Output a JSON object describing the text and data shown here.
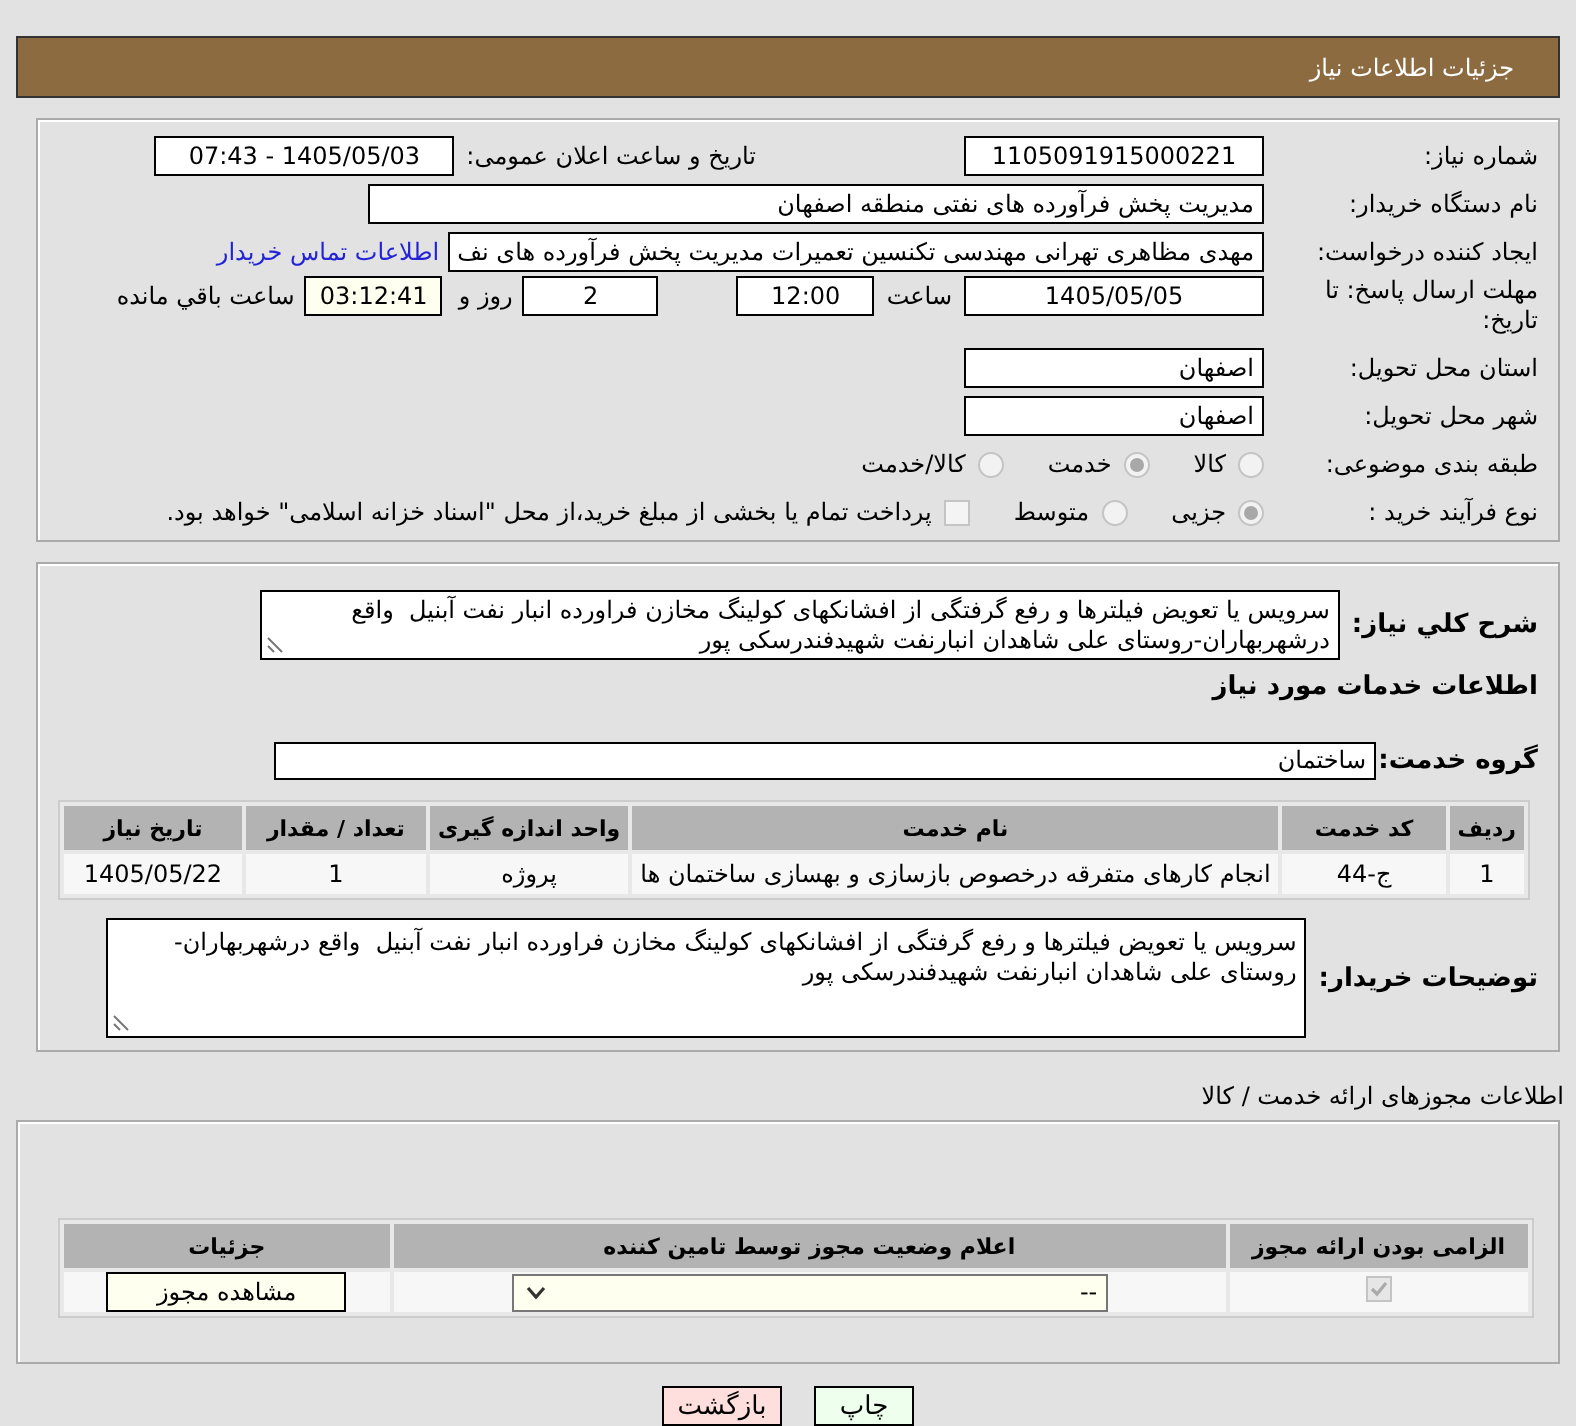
{
  "header": {
    "title": "جزئیات اطلاعات نیاز"
  },
  "need_details": {
    "need_number": {
      "label": "شماره نیاز:",
      "value": "1105091915000221"
    },
    "announcement": {
      "label": "تاریخ و ساعت اعلان عمومی:",
      "value": "1405/05/03 - 07:43"
    },
    "buyer_org": {
      "label": "نام دستگاه خریدار:",
      "value": "مدیریت پخش فرآورده های نفتی منطقه اصفهان"
    },
    "requester": {
      "label": "ایجاد کننده درخواست:",
      "value": "مهدی مظاهری تهرانی مهندسی تکنسین تعمیرات مدیریت پخش فرآورده های نف",
      "link": "اطلاعات تماس خریدار"
    },
    "deadline": {
      "label": "مهلت ارسال پاسخ: تا تاریخ:",
      "date": "1405/05/05",
      "time_label": "ساعت",
      "time": "12:00",
      "days": "2",
      "days_label": "روز و",
      "remaining": "03:12:41",
      "remaining_label": "ساعت باقي مانده"
    },
    "province": {
      "label": "استان محل تحویل:",
      "value": "اصفهان"
    },
    "city": {
      "label": "شهر محل تحویل:",
      "value": "اصفهان"
    },
    "category": {
      "label": "طبقه بندی موضوعی:",
      "options": [
        {
          "label": "کالا",
          "selected": false
        },
        {
          "label": "خدمت",
          "selected": true
        },
        {
          "label": "کالا/خدمت",
          "selected": false
        }
      ]
    },
    "purchase_type": {
      "label": "نوع فرآیند خرید :",
      "options": [
        {
          "label": "جزیی",
          "selected": true
        },
        {
          "label": "متوسط",
          "selected": false
        }
      ],
      "treasury": {
        "label": "پرداخت تمام یا بخشی از مبلغ خرید،از محل \"اسناد خزانه اسلامی\" خواهد بود.",
        "checked": false
      }
    }
  },
  "services": {
    "summary": {
      "label": "شرح کلي نیاز:",
      "value": "سرویس یا تعویض فیلترها و رفع گرفتگی از افشانکهای کولینگ مخازن فراورده انبار نفت آبنیل  واقع درشهربهاران-روستای علی شاهدان انبارنفت شهیدفندرسکی پور"
    },
    "heading": "اطلاعات خدمات مورد نیاز",
    "service_group": {
      "label": "گروه خدمت:",
      "value": "ساختمان"
    },
    "table": {
      "columns": [
        "ردیف",
        "کد خدمت",
        "نام خدمت",
        "واحد اندازه گیری",
        "تعداد / مقدار",
        "تاریخ نیاز"
      ],
      "rows": [
        [
          "1",
          "ج-44",
          "انجام کارهای متفرقه درخصوص بازسازی و بهسازی ساختمان ها",
          "پروژه",
          "1",
          "1405/05/22"
        ]
      ]
    },
    "buyer_notes": {
      "label": "توضیحات خریدار:",
      "value": "سرویس یا تعویض فیلترها و رفع گرفتگی از افشانکهای کولینگ مخازن فراورده انبار نفت آبنیل  واقع درشهربهاران-روستای علی شاهدان انبارنفت شهیدفندرسکی پور"
    }
  },
  "permits": {
    "heading": "اطلاعات مجوزهای ارائه خدمت / کالا",
    "table": {
      "columns": [
        "الزامی بودن ارائه مجوز",
        "اعلام وضعیت مجوز توسط تامین کننده",
        "جزئیات"
      ],
      "rows": [
        {
          "required": true,
          "status": "--",
          "button": "مشاهده مجوز"
        }
      ]
    }
  },
  "actions": [
    {
      "label": "چاپ",
      "kind": "print"
    },
    {
      "label": "بازگشت",
      "kind": "back"
    }
  ]
}
